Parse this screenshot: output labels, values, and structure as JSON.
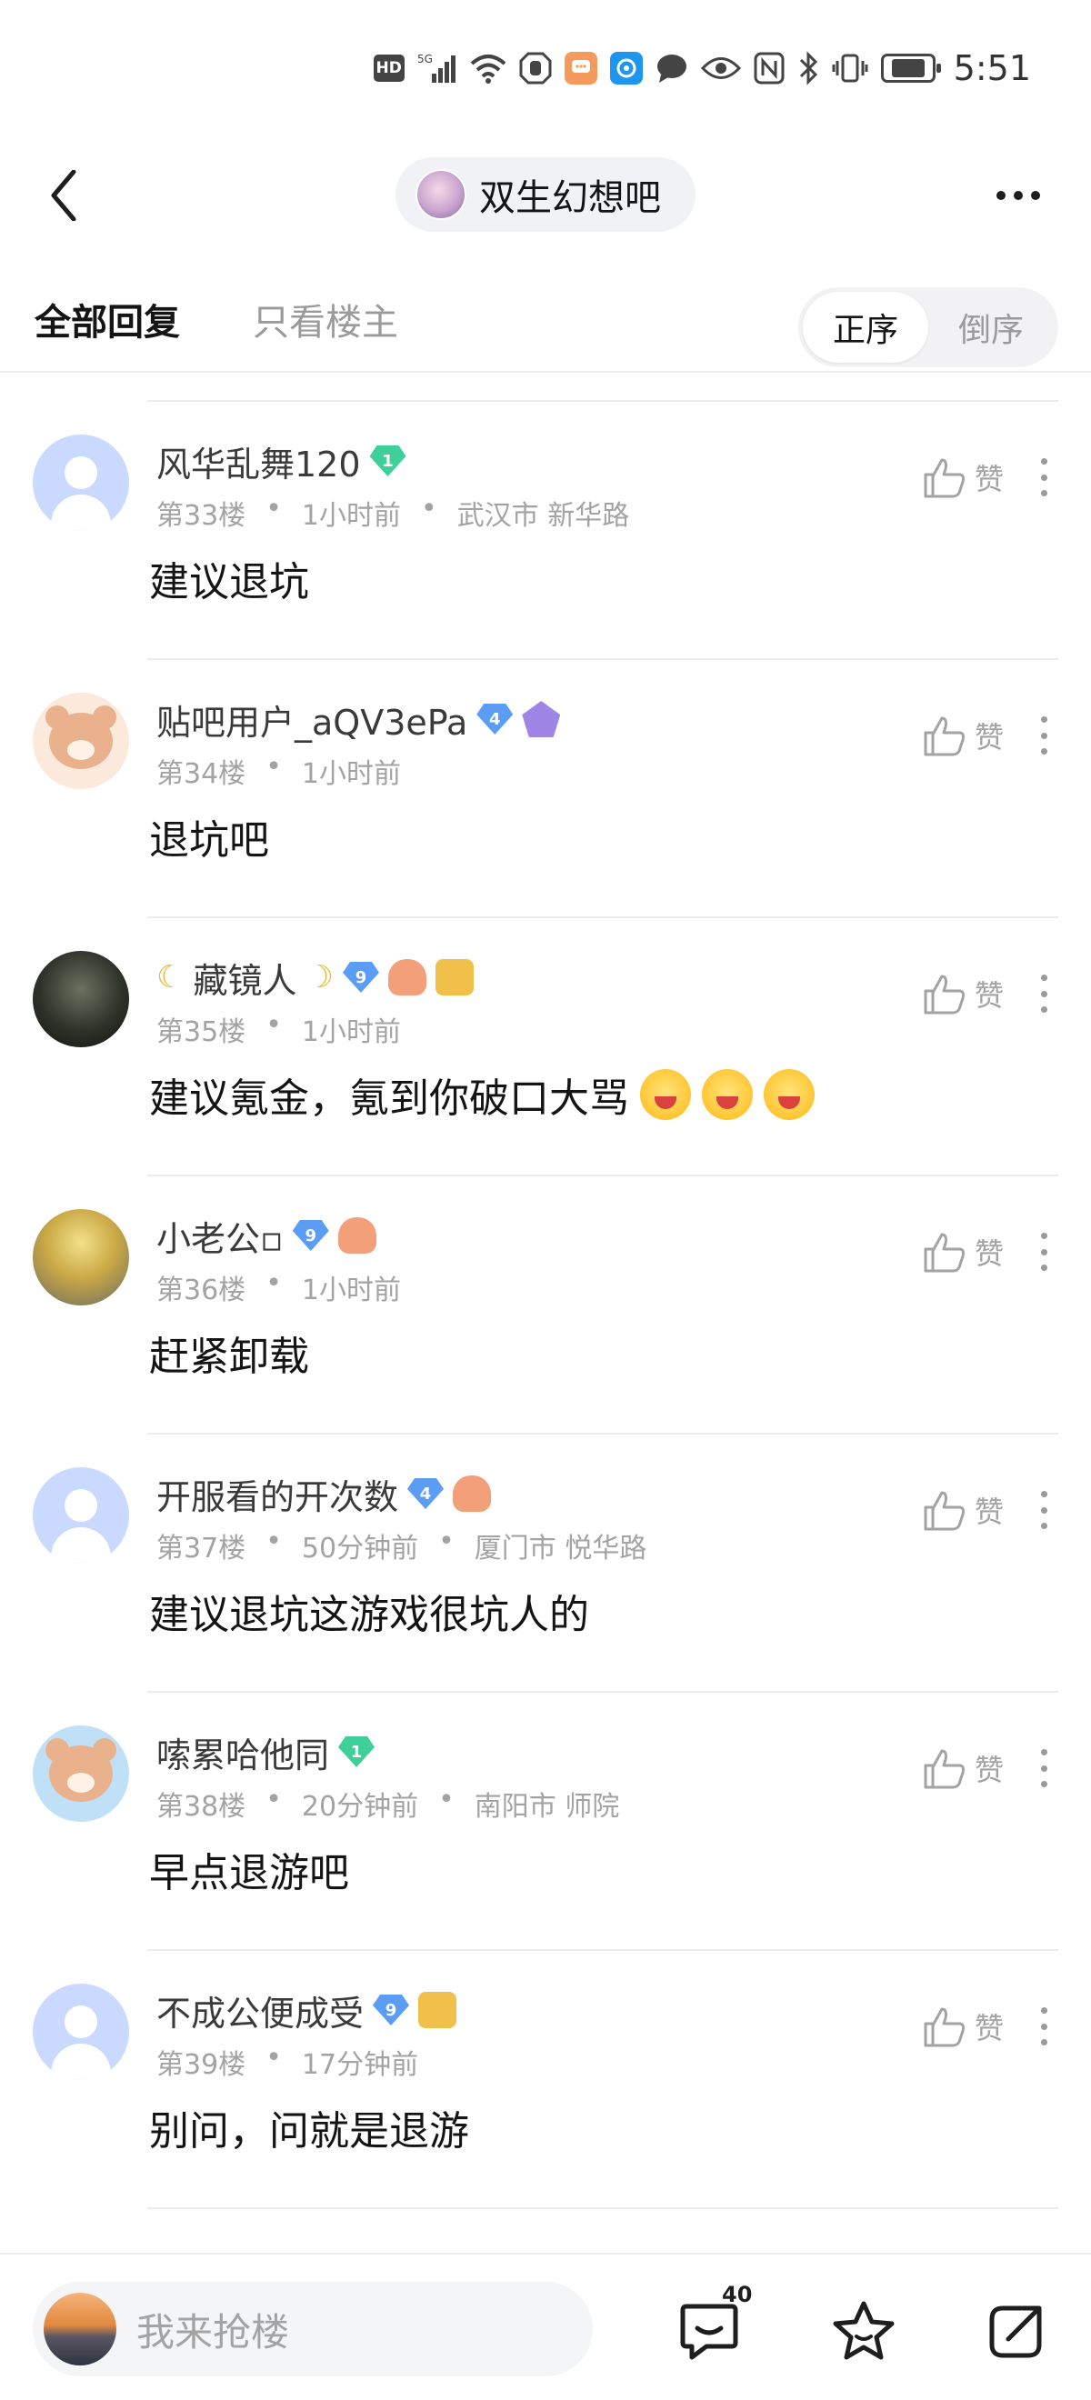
{
  "status_bar": {
    "hd_label": "HD",
    "network": "5G",
    "time": "5:51",
    "battery_level": 0.75
  },
  "header": {
    "forum_name": "双生幻想吧",
    "back_icon": "chevron-left-icon",
    "more_icon": "more-horizontal-icon"
  },
  "tabs": {
    "all_replies": "全部回复",
    "op_only": "只看楼主",
    "sort_asc": "正序",
    "sort_desc": "倒序",
    "active_sort": "正序"
  },
  "posts": [
    {
      "username": "风华乱舞120",
      "level": "1",
      "floor": "第33楼",
      "time": "1小时前",
      "location": "武汉市 新华路",
      "content": "建议退坑",
      "like_label": "赞"
    },
    {
      "username": "贴吧用户_aQV3ePa",
      "level": "4",
      "floor": "第34楼",
      "time": "1小时前",
      "location": "",
      "content": "退坑吧",
      "like_label": "赞"
    },
    {
      "username": "藏镜人",
      "level": "9",
      "floor": "第35楼",
      "time": "1小时前",
      "location": "",
      "content": "建议氪金，氪到你破口大骂",
      "like_label": "赞"
    },
    {
      "username": "小老公▫",
      "level": "9",
      "floor": "第36楼",
      "time": "1小时前",
      "location": "",
      "content": "赶紧卸载",
      "like_label": "赞"
    },
    {
      "username": "开服看的开次数",
      "level": "4",
      "floor": "第37楼",
      "time": "50分钟前",
      "location": "厦门市 悦华路",
      "content": "建议退坑这游戏很坑人的",
      "like_label": "赞"
    },
    {
      "username": "嗦累哈他同",
      "level": "1",
      "floor": "第38楼",
      "time": "20分钟前",
      "location": "南阳市 师院",
      "content": "早点退游吧",
      "like_label": "赞"
    },
    {
      "username": "不成公便成受",
      "level": "9",
      "floor": "第39楼",
      "time": "17分钟前",
      "location": "",
      "content": "别问，问就是退游",
      "like_label": "赞"
    }
  ],
  "bottom_bar": {
    "placeholder": "我来抢楼",
    "comment_count": "40"
  },
  "colors": {
    "accent_green": "#3fcf9b",
    "accent_blue": "#5b9df5",
    "muted_text": "#a3a3a3"
  }
}
